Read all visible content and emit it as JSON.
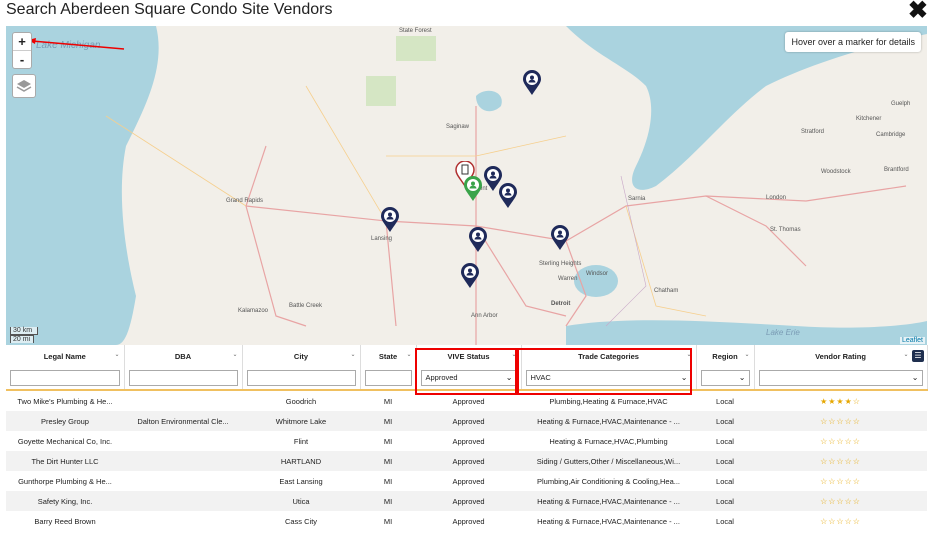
{
  "dialog": {
    "title": "Search Aberdeen Square Condo Site Vendors",
    "close": "✖"
  },
  "map": {
    "hint": "Hover over a marker for details",
    "zoom_in": "+",
    "zoom_out": "-",
    "scale_km": "30 km",
    "scale_mi": "20 mi",
    "attribution": "Leaflet",
    "lake_michigan": "Lake Michigan",
    "lake_erie": "Lake Erie",
    "places": [
      "Grand Rapids",
      "Lansing",
      "Kalamazoo",
      "Battle Creek",
      "Saginaw",
      "Flint",
      "Ann Arbor",
      "Detroit",
      "Sterling Heights",
      "Warren",
      "Windsor",
      "Sarnia",
      "London",
      "Stratford",
      "Kitchener",
      "Guelph",
      "Cambridge",
      "Woodstock",
      "Brantford",
      "St. Thomas",
      "Chatham",
      "State Forest"
    ]
  },
  "table": {
    "columns": [
      "Legal Name",
      "DBA",
      "City",
      "State",
      "VIVE Status",
      "Trade Categories",
      "Region",
      "Vendor Rating"
    ],
    "filters": {
      "vive_status": "Approved",
      "trade_categories": "HVAC"
    },
    "rows": [
      {
        "legal_name": "Two Mike's Plumbing & He...",
        "dba": "",
        "city": "Goodrich",
        "state": "MI",
        "status": "Approved",
        "trades": "Plumbing,Heating & Furnace,HVAC",
        "region": "Local",
        "rating": "★★★★☆"
      },
      {
        "legal_name": "Presley Group",
        "dba": "Dalton Environmental Cle...",
        "city": "Whitmore Lake",
        "state": "MI",
        "status": "Approved",
        "trades": "Heating & Furnace,HVAC,Maintenance - ...",
        "region": "Local",
        "rating": "☆☆☆☆☆"
      },
      {
        "legal_name": "Goyette Mechanical Co, Inc.",
        "dba": "",
        "city": "Flint",
        "state": "MI",
        "status": "Approved",
        "trades": "Heating & Furnace,HVAC,Plumbing",
        "region": "Local",
        "rating": "☆☆☆☆☆"
      },
      {
        "legal_name": "The Dirt Hunter LLC",
        "dba": "",
        "city": "HARTLAND",
        "state": "MI",
        "status": "Approved",
        "trades": "Siding / Gutters,Other / Miscellaneous,Wi...",
        "region": "Local",
        "rating": "☆☆☆☆☆"
      },
      {
        "legal_name": "Gunthorpe Plumbing & He...",
        "dba": "",
        "city": "East Lansing",
        "state": "MI",
        "status": "Approved",
        "trades": "Plumbing,Air Conditioning & Cooling,Hea...",
        "region": "Local",
        "rating": "☆☆☆☆☆"
      },
      {
        "legal_name": "Safety King, Inc.",
        "dba": "",
        "city": "Utica",
        "state": "MI",
        "status": "Approved",
        "trades": "Heating & Furnace,HVAC,Maintenance - ...",
        "region": "Local",
        "rating": "☆☆☆☆☆"
      },
      {
        "legal_name": "Barry Reed Brown",
        "dba": "",
        "city": "Cass City",
        "state": "MI",
        "status": "Approved",
        "trades": "Heating & Furnace,HVAC,Maintenance - ...",
        "region": "Local",
        "rating": "☆☆☆☆☆"
      }
    ]
  },
  "colors": {
    "marker": "#1f2a5a",
    "marker_green": "#3aa34a",
    "marker_red": "#b03030",
    "highlight": "#e00000",
    "star": "#e6a700"
  }
}
